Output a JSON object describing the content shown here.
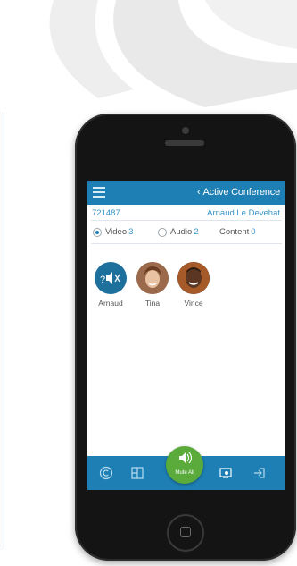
{
  "background": {
    "accent_color": "#ececec"
  },
  "topbar": {
    "title": "Active Conference",
    "back_icon": "chevron-left-icon",
    "menu_icon": "hamburger-menu-icon"
  },
  "conference": {
    "id": "721487",
    "presenter": "Arnaud Le Devehat"
  },
  "tabs": [
    {
      "label": "Video",
      "count": "3",
      "selected": true
    },
    {
      "label": "Audio",
      "count": "2",
      "selected": false
    },
    {
      "label": "Content",
      "count": "0",
      "selected": false
    }
  ],
  "participants": [
    {
      "name": "Arnaud",
      "icon": "muted-speaker-icon"
    },
    {
      "name": "Tina",
      "icon": "avatar-photo"
    },
    {
      "name": "Vince",
      "icon": "avatar-photo"
    }
  ],
  "bottombar": {
    "icons": [
      "copyright-icon",
      "layout-grid-icon",
      "share-screen-icon",
      "exit-icon"
    ],
    "mute_all_label": "Mute All"
  },
  "colors": {
    "brand_blue": "#1d7fb4",
    "link_blue": "#3a93c6",
    "mute_green": "#5aab3c"
  }
}
